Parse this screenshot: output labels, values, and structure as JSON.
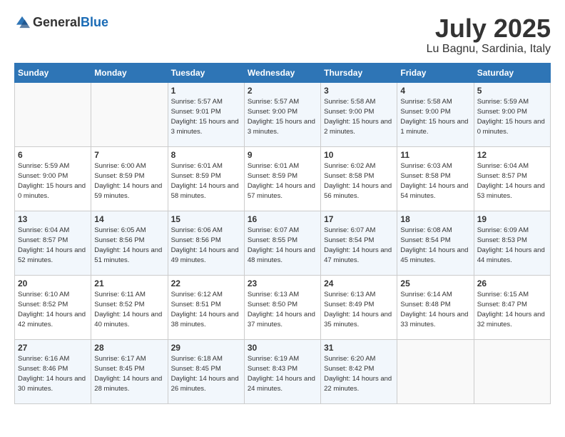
{
  "header": {
    "logo": {
      "text_general": "General",
      "text_blue": "Blue"
    },
    "title": "July 2025",
    "location": "Lu Bagnu, Sardinia, Italy"
  },
  "weekdays": [
    "Sunday",
    "Monday",
    "Tuesday",
    "Wednesday",
    "Thursday",
    "Friday",
    "Saturday"
  ],
  "weeks": [
    [
      {
        "day": "",
        "info": ""
      },
      {
        "day": "",
        "info": ""
      },
      {
        "day": "1",
        "sunrise": "5:57 AM",
        "sunset": "9:01 PM",
        "daylight": "15 hours and 3 minutes."
      },
      {
        "day": "2",
        "sunrise": "5:57 AM",
        "sunset": "9:00 PM",
        "daylight": "15 hours and 3 minutes."
      },
      {
        "day": "3",
        "sunrise": "5:58 AM",
        "sunset": "9:00 PM",
        "daylight": "15 hours and 2 minutes."
      },
      {
        "day": "4",
        "sunrise": "5:58 AM",
        "sunset": "9:00 PM",
        "daylight": "15 hours and 1 minute."
      },
      {
        "day": "5",
        "sunrise": "5:59 AM",
        "sunset": "9:00 PM",
        "daylight": "15 hours and 0 minutes."
      }
    ],
    [
      {
        "day": "6",
        "sunrise": "5:59 AM",
        "sunset": "9:00 PM",
        "daylight": "15 hours and 0 minutes."
      },
      {
        "day": "7",
        "sunrise": "6:00 AM",
        "sunset": "8:59 PM",
        "daylight": "14 hours and 59 minutes."
      },
      {
        "day": "8",
        "sunrise": "6:01 AM",
        "sunset": "8:59 PM",
        "daylight": "14 hours and 58 minutes."
      },
      {
        "day": "9",
        "sunrise": "6:01 AM",
        "sunset": "8:59 PM",
        "daylight": "14 hours and 57 minutes."
      },
      {
        "day": "10",
        "sunrise": "6:02 AM",
        "sunset": "8:58 PM",
        "daylight": "14 hours and 56 minutes."
      },
      {
        "day": "11",
        "sunrise": "6:03 AM",
        "sunset": "8:58 PM",
        "daylight": "14 hours and 54 minutes."
      },
      {
        "day": "12",
        "sunrise": "6:04 AM",
        "sunset": "8:57 PM",
        "daylight": "14 hours and 53 minutes."
      }
    ],
    [
      {
        "day": "13",
        "sunrise": "6:04 AM",
        "sunset": "8:57 PM",
        "daylight": "14 hours and 52 minutes."
      },
      {
        "day": "14",
        "sunrise": "6:05 AM",
        "sunset": "8:56 PM",
        "daylight": "14 hours and 51 minutes."
      },
      {
        "day": "15",
        "sunrise": "6:06 AM",
        "sunset": "8:56 PM",
        "daylight": "14 hours and 49 minutes."
      },
      {
        "day": "16",
        "sunrise": "6:07 AM",
        "sunset": "8:55 PM",
        "daylight": "14 hours and 48 minutes."
      },
      {
        "day": "17",
        "sunrise": "6:07 AM",
        "sunset": "8:54 PM",
        "daylight": "14 hours and 47 minutes."
      },
      {
        "day": "18",
        "sunrise": "6:08 AM",
        "sunset": "8:54 PM",
        "daylight": "14 hours and 45 minutes."
      },
      {
        "day": "19",
        "sunrise": "6:09 AM",
        "sunset": "8:53 PM",
        "daylight": "14 hours and 44 minutes."
      }
    ],
    [
      {
        "day": "20",
        "sunrise": "6:10 AM",
        "sunset": "8:52 PM",
        "daylight": "14 hours and 42 minutes."
      },
      {
        "day": "21",
        "sunrise": "6:11 AM",
        "sunset": "8:52 PM",
        "daylight": "14 hours and 40 minutes."
      },
      {
        "day": "22",
        "sunrise": "6:12 AM",
        "sunset": "8:51 PM",
        "daylight": "14 hours and 38 minutes."
      },
      {
        "day": "23",
        "sunrise": "6:13 AM",
        "sunset": "8:50 PM",
        "daylight": "14 hours and 37 minutes."
      },
      {
        "day": "24",
        "sunrise": "6:13 AM",
        "sunset": "8:49 PM",
        "daylight": "14 hours and 35 minutes."
      },
      {
        "day": "25",
        "sunrise": "6:14 AM",
        "sunset": "8:48 PM",
        "daylight": "14 hours and 33 minutes."
      },
      {
        "day": "26",
        "sunrise": "6:15 AM",
        "sunset": "8:47 PM",
        "daylight": "14 hours and 32 minutes."
      }
    ],
    [
      {
        "day": "27",
        "sunrise": "6:16 AM",
        "sunset": "8:46 PM",
        "daylight": "14 hours and 30 minutes."
      },
      {
        "day": "28",
        "sunrise": "6:17 AM",
        "sunset": "8:45 PM",
        "daylight": "14 hours and 28 minutes."
      },
      {
        "day": "29",
        "sunrise": "6:18 AM",
        "sunset": "8:45 PM",
        "daylight": "14 hours and 26 minutes."
      },
      {
        "day": "30",
        "sunrise": "6:19 AM",
        "sunset": "8:43 PM",
        "daylight": "14 hours and 24 minutes."
      },
      {
        "day": "31",
        "sunrise": "6:20 AM",
        "sunset": "8:42 PM",
        "daylight": "14 hours and 22 minutes."
      },
      {
        "day": "",
        "info": ""
      },
      {
        "day": "",
        "info": ""
      }
    ]
  ]
}
